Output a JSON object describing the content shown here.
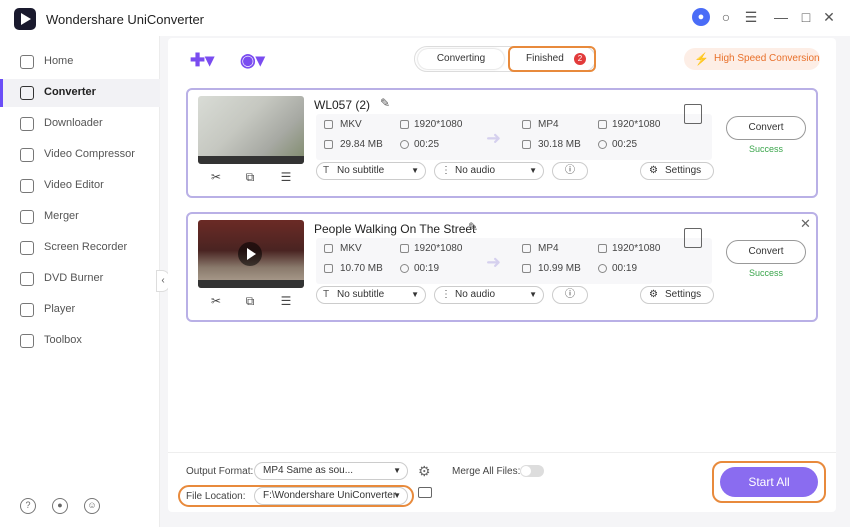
{
  "app": {
    "title": "Wondershare UniConverter"
  },
  "window_icons": [
    "user-icon",
    "headset-icon",
    "menu-icon",
    "minimize-icon",
    "maximize-icon",
    "close-icon"
  ],
  "sidebar": {
    "items": [
      {
        "label": "Home",
        "icon": "home-icon"
      },
      {
        "label": "Converter",
        "icon": "converter-icon",
        "active": true
      },
      {
        "label": "Downloader",
        "icon": "downloader-icon"
      },
      {
        "label": "Video Compressor",
        "icon": "compressor-icon"
      },
      {
        "label": "Video Editor",
        "icon": "scissors-icon"
      },
      {
        "label": "Merger",
        "icon": "merger-icon"
      },
      {
        "label": "Screen Recorder",
        "icon": "recorder-icon"
      },
      {
        "label": "DVD Burner",
        "icon": "dvd-icon"
      },
      {
        "label": "Player",
        "icon": "player-icon"
      },
      {
        "label": "Toolbox",
        "icon": "toolbox-icon"
      }
    ]
  },
  "tabs": {
    "converting": "Converting",
    "finished": "Finished",
    "finished_count": "2"
  },
  "high_speed": "High Speed Conversion",
  "files": [
    {
      "name": "WL057 (2)",
      "source": {
        "format": "MKV",
        "resolution": "1920*1080",
        "size": "29.84 MB",
        "duration": "00:25"
      },
      "target": {
        "format": "MP4",
        "resolution": "1920*1080",
        "size": "30.18 MB",
        "duration": "00:25"
      },
      "subtitle": "No subtitle",
      "audio": "No audio",
      "settings": "Settings",
      "convert": "Convert",
      "status": "Success"
    },
    {
      "name": "People Walking On The Street",
      "source": {
        "format": "MKV",
        "resolution": "1920*1080",
        "size": "10.70 MB",
        "duration": "00:19"
      },
      "target": {
        "format": "MP4",
        "resolution": "1920*1080",
        "size": "10.99 MB",
        "duration": "00:19"
      },
      "subtitle": "No subtitle",
      "audio": "No audio",
      "settings": "Settings",
      "convert": "Convert",
      "status": "Success"
    }
  ],
  "bottom": {
    "output_format_label": "Output Format:",
    "output_format_value": "MP4 Same as sou...",
    "merge_label": "Merge All Files:",
    "file_location_label": "File Location:",
    "file_location_value": "F:\\Wondershare UniConverter",
    "start_all": "Start All"
  },
  "colors": {
    "accent": "#7a4cf0",
    "highlight": "#e88a3c",
    "success": "#3aa54b",
    "badge": "#e23b3b"
  }
}
